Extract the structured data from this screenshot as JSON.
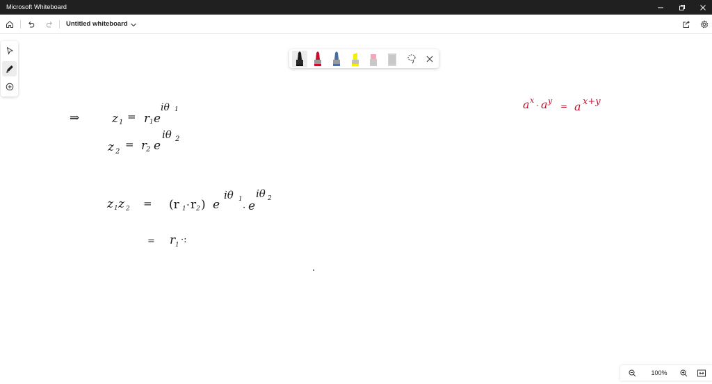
{
  "window": {
    "title": "Microsoft Whiteboard",
    "controls": [
      "minimize",
      "restore",
      "close"
    ]
  },
  "toolbar": {
    "board_title": "Untitled whiteboard",
    "left_icons": [
      "home-icon",
      "undo-icon",
      "redo-icon"
    ],
    "right_icons": [
      "share-icon",
      "settings-icon"
    ]
  },
  "left_tools": [
    "select-icon",
    "pen-icon",
    "add-icon"
  ],
  "pen_tray": {
    "pens": [
      {
        "name": "black-pen",
        "color": "#1a1a1a",
        "active": true
      },
      {
        "name": "red-pen",
        "color": "#c8102e",
        "active": false
      },
      {
        "name": "blue-pen",
        "color": "#4a6fa5",
        "active": false
      },
      {
        "name": "highlighter-yellow",
        "color": "#f3f000",
        "active": false
      },
      {
        "name": "eraser-pink",
        "color": "#f0a8b8",
        "active": false
      },
      {
        "name": "ruler",
        "color": "#c8c8c8",
        "active": false
      }
    ],
    "extra_icons": [
      "lasso-icon",
      "close-icon"
    ]
  },
  "canvas": {
    "ink_colors": {
      "main": "#1a1a1a",
      "accent": "#c8102e"
    },
    "handwriting": {
      "implies": "⇒",
      "z1_lhs": "z",
      "z1_sub": "1",
      "z1_eq": "=",
      "z1_r": "r",
      "z1_r_sub": "1",
      "z1_e": "e",
      "z1_exp": "iθ",
      "z1_exp_sub": "1",
      "z2_lhs": "z",
      "z2_sub": "2",
      "z2_eq": "=",
      "z2_r": "r",
      "z2_r_sub": "2",
      "z2_e": "e",
      "z2_exp": "iθ",
      "z2_exp_sub": "2",
      "prod_lhs": "z",
      "prod_sub1": "1",
      "prod_z": "z",
      "prod_sub2": "2",
      "prod_eq": "=",
      "prod_open": "(r",
      "prod_r1_sub": "1",
      "prod_dot": "·",
      "prod_r2": "r",
      "prod_r2_sub": "2",
      "prod_close": ")",
      "prod_e1": "e",
      "prod_e1_exp": "iθ",
      "prod_e1_exp_sub": "1",
      "prod_dot2": "·",
      "prod_e2": "e",
      "prod_e2_exp": "iθ",
      "prod_e2_exp_sub": "2",
      "line4_eq": "=",
      "line4_r": "r",
      "line4_sub": "1",
      "line4_tail": "·:",
      "red_a1": "a",
      "red_x1": "x",
      "red_dot": "·",
      "red_a2": "a",
      "red_y": "y",
      "red_eq": "=",
      "red_a3": "a",
      "red_xy": "x+y"
    }
  },
  "zoom": {
    "level": "100%",
    "icons": [
      "zoom-out-icon",
      "zoom-in-icon",
      "fit-icon"
    ]
  }
}
